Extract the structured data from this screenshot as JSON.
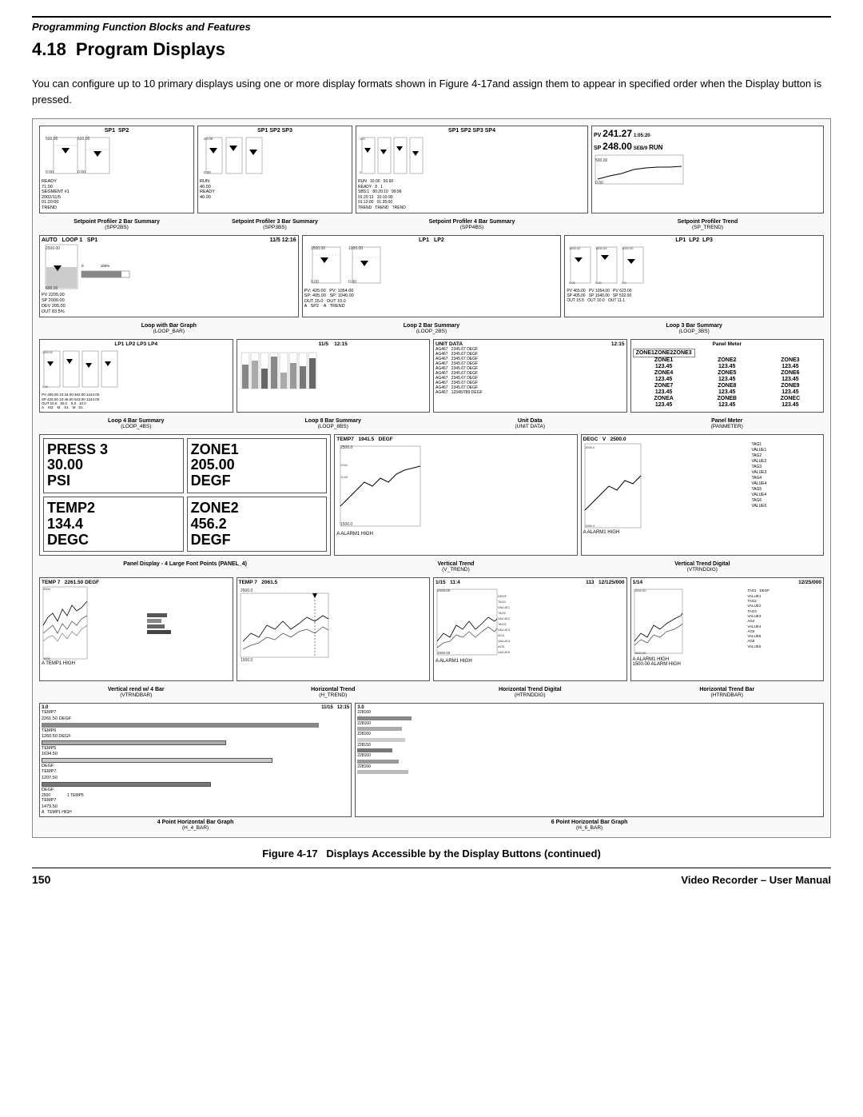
{
  "header": {
    "section": "Programming Function Blocks and Features"
  },
  "chapter": {
    "number": "4.18",
    "title": "Program Displays"
  },
  "intro": "You can configure up to 10 primary displays using one or more display formats shown in Figure 4-17and assign them to appear in specified order when the Display button is pressed.",
  "figure": {
    "number": "4-17",
    "caption": "Figure 4-17  Displays Accessible by the Display Buttons",
    "caption_continued": "(continued)"
  },
  "displays": {
    "row1": [
      {
        "name": "SPP2BS",
        "label": "Setpoint Profiler 2 Bar Summary",
        "sublabel": "(SPP2BS)",
        "tags": [
          "SP1",
          "SP2"
        ]
      },
      {
        "name": "SPP3BS",
        "label": "Setpoint Profiler 3 Bar Summary",
        "sublabel": "(SPP3BS)",
        "tags": [
          "SP1",
          "SP2",
          "SP3"
        ]
      },
      {
        "name": "SPP4BS",
        "label": "Setpoint Profiler 4 Bar Summary",
        "sublabel": "(SPP4BS)",
        "tags": [
          "SP1",
          "SP2",
          "SP3",
          "SP4"
        ]
      },
      {
        "name": "SP_TREND",
        "label": "Setpoint Profiler Trend",
        "sublabel": "(SP_TREND)"
      }
    ],
    "row2": [
      {
        "name": "LOOP_BAR",
        "label": "Loop with Bar Graph",
        "sublabel": "(LOOP_BAR)",
        "loop": "LOOP 1",
        "pv": "PV 2205.00",
        "sp": "SP 2000.00",
        "dev": "DEV 205.00",
        "out": "OUT 83.5%"
      },
      {
        "name": "LOOP_2BS",
        "label": "Loop 2 Bar Summary",
        "sublabel": "(LOOP_2BS)",
        "tags": [
          "LP1",
          "LP2"
        ]
      },
      {
        "name": "LOOP_3BS",
        "label": "Loop 3 Bar Summary",
        "sublabel": "(LOOP_3BS)",
        "tags": [
          "LP1",
          "LP2",
          "LP3"
        ]
      }
    ],
    "row3": [
      {
        "name": "LOOP_4BS",
        "label": "Loop 4 Bar Summary",
        "sublabel": "(LOOP_4BS)",
        "tags": [
          "LP1",
          "LP2",
          "LP3",
          "LP4"
        ]
      },
      {
        "name": "LOOP_8BS",
        "label": "Loop 8 Bar Summary",
        "sublabel": "(LOOP_8BS)"
      },
      {
        "name": "UNIT_DATA",
        "label": "Unit Data",
        "sublabel": "(UNIT DATA)"
      },
      {
        "name": "PANMETER",
        "label": "Panel Meter",
        "sublabel": "(PANMETER)"
      }
    ],
    "row4": [
      {
        "name": "PANEL_4",
        "label": "Panel Display - 4 Large Font Points",
        "sublabel": "(PANEL_4)",
        "lines": [
          {
            "tag": "PRESS 3",
            "zone": "ZONE1",
            "val1": "30.00",
            "val2": "205.00",
            "unit1": "PSI",
            "unit2": "DEGF"
          },
          {
            "tag": "TEMP2",
            "zone": "ZONE2",
            "val1": "134.4",
            "val2": "456.2",
            "unit1": "DEGC",
            "unit2": "DEGF"
          }
        ]
      },
      {
        "name": "V_TREND",
        "label": "Vertical Trend",
        "sublabel": "(V_TREND)",
        "tag": "TEMP7",
        "value": "1941.5",
        "unit": "DEGF"
      },
      {
        "name": "VTRNDDIG",
        "label": "Vertical Trend Digital",
        "sublabel": "(VTRNDDIG)"
      }
    ],
    "row5": [
      {
        "name": "VTRNDBAR",
        "label": "Vertical rend w/ 4 Bar",
        "sublabel": "(VTRNDBAR)",
        "alarm": "A TEMP1 HIGH"
      },
      {
        "name": "H_TREND",
        "label": "Horizontal Trend",
        "sublabel": "(H_TREND)",
        "tag": "TEMP 7",
        "value": "2061.5"
      },
      {
        "name": "HTRNDDIG",
        "label": "Horizontal Trend Digital",
        "sublabel": "(HTRNDDIG)",
        "alarm": "A ALARM1 HIGH"
      },
      {
        "name": "HTRNDBAR",
        "label": "Horizontal Trend Bar",
        "sublabel": "(HTRNDBAR)",
        "alarm": "A ALARM1 HIGH",
        "alarm_value": "1500.00 ALARM HIGH"
      }
    ],
    "row6": [
      {
        "name": "H_4_BAR",
        "label": "4 Point Horizontal Bar Graph",
        "sublabel": "(H_4_BAR)"
      },
      {
        "name": "H_6_BAR",
        "label": "6 Point Horizontal Bar Graph",
        "sublabel": "(H_6_BAR)"
      }
    ]
  },
  "footer": {
    "page": "150",
    "title": "Video Recorder – User Manual"
  }
}
